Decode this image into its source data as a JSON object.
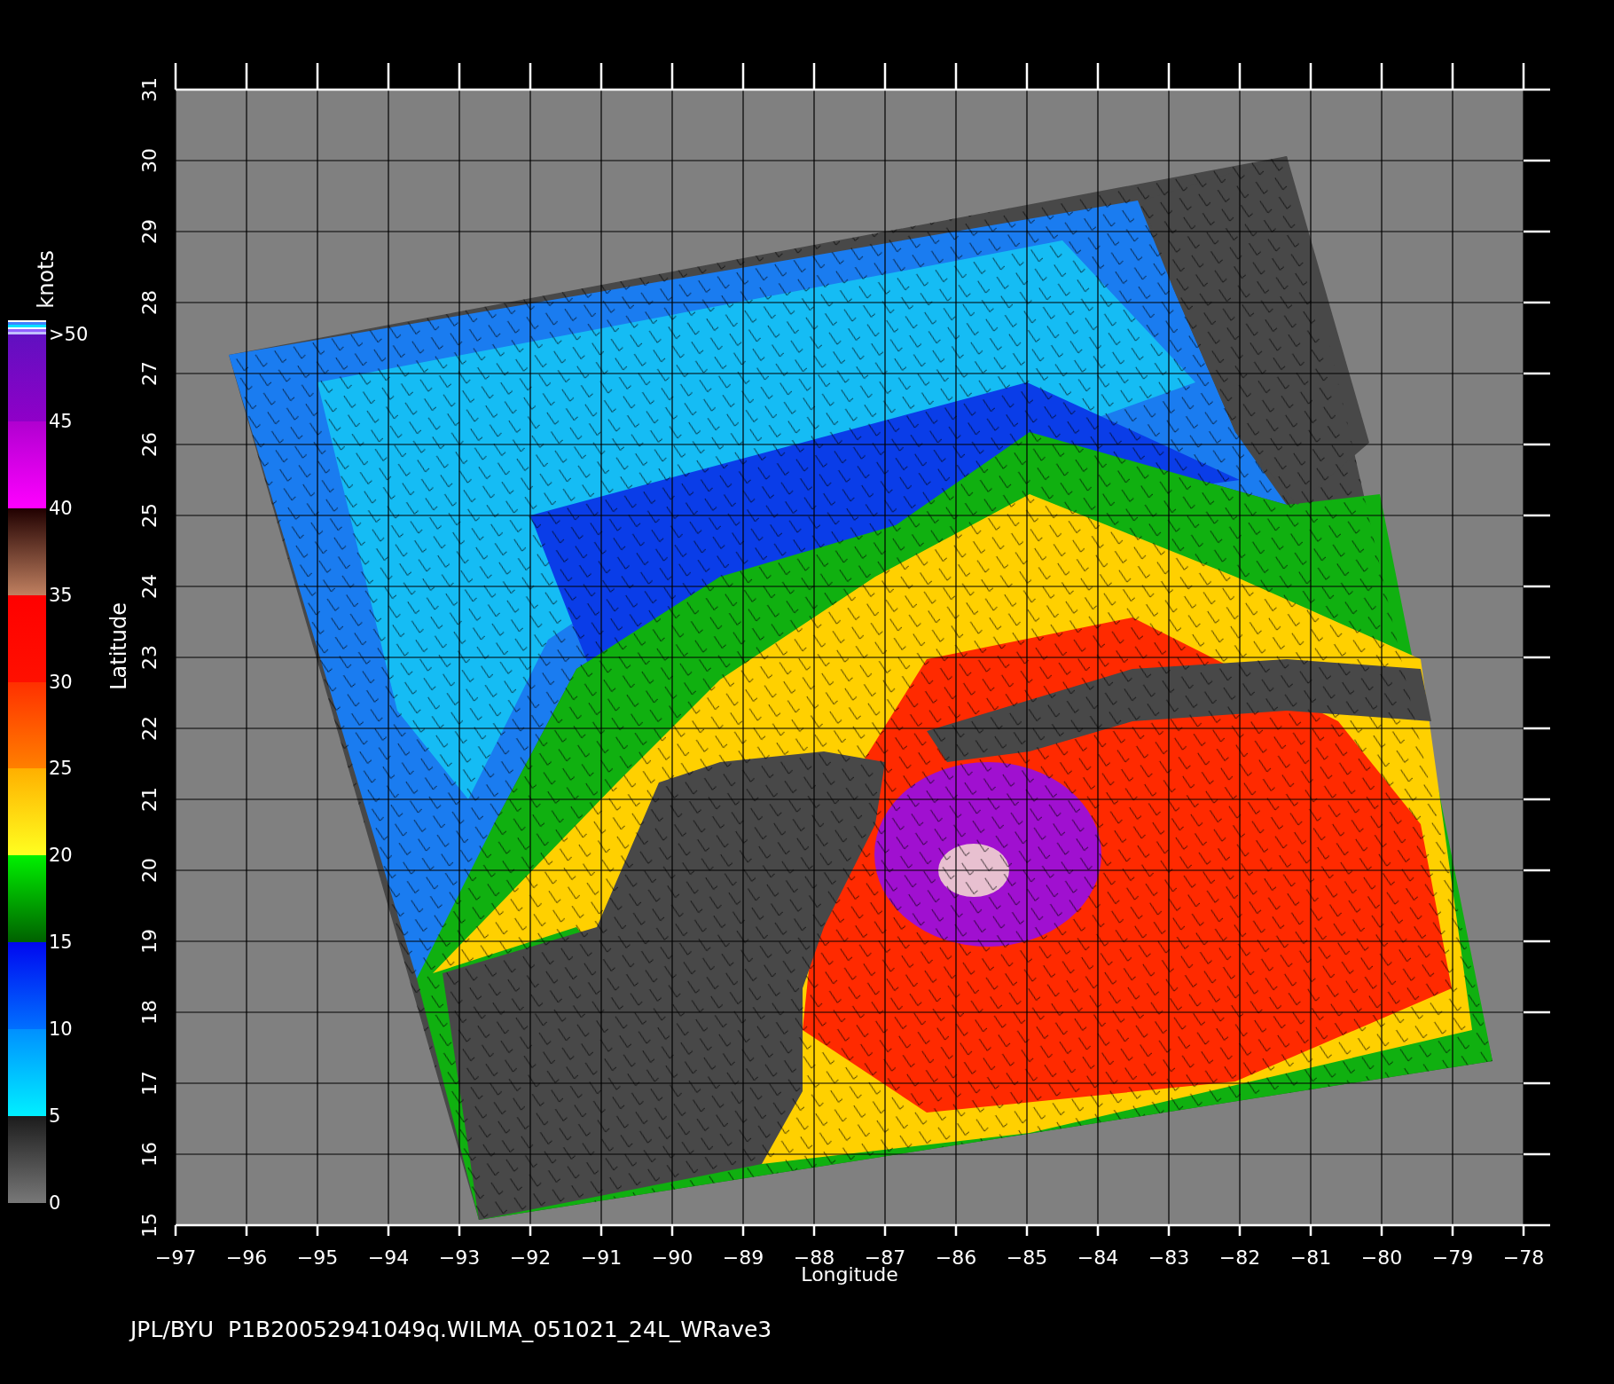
{
  "colorbar": {
    "unit": "knots",
    "labels": [
      ">50",
      "45",
      "40",
      "35",
      "30",
      "25",
      "20",
      "15",
      "10",
      "5",
      "0"
    ]
  },
  "y_axis": {
    "title": "Latitude",
    "ticks": [
      "31",
      "30",
      "29",
      "28",
      "27",
      "26",
      "25",
      "24",
      "23",
      "22",
      "21",
      "20",
      "19",
      "18",
      "17",
      "16",
      "15"
    ]
  },
  "x_axis": {
    "title": "Longitude",
    "ticks": [
      "−97",
      "−96",
      "−95",
      "−94",
      "−93",
      "−92",
      "−91",
      "−90",
      "−89",
      "−88",
      "−87",
      "−86",
      "−85",
      "−84",
      "−83",
      "−82",
      "−81",
      "−80",
      "−79",
      "−78"
    ]
  },
  "footer": "JPL/BYU  P1B20052941049q.WILMA_051021_24L_WRave3"
}
